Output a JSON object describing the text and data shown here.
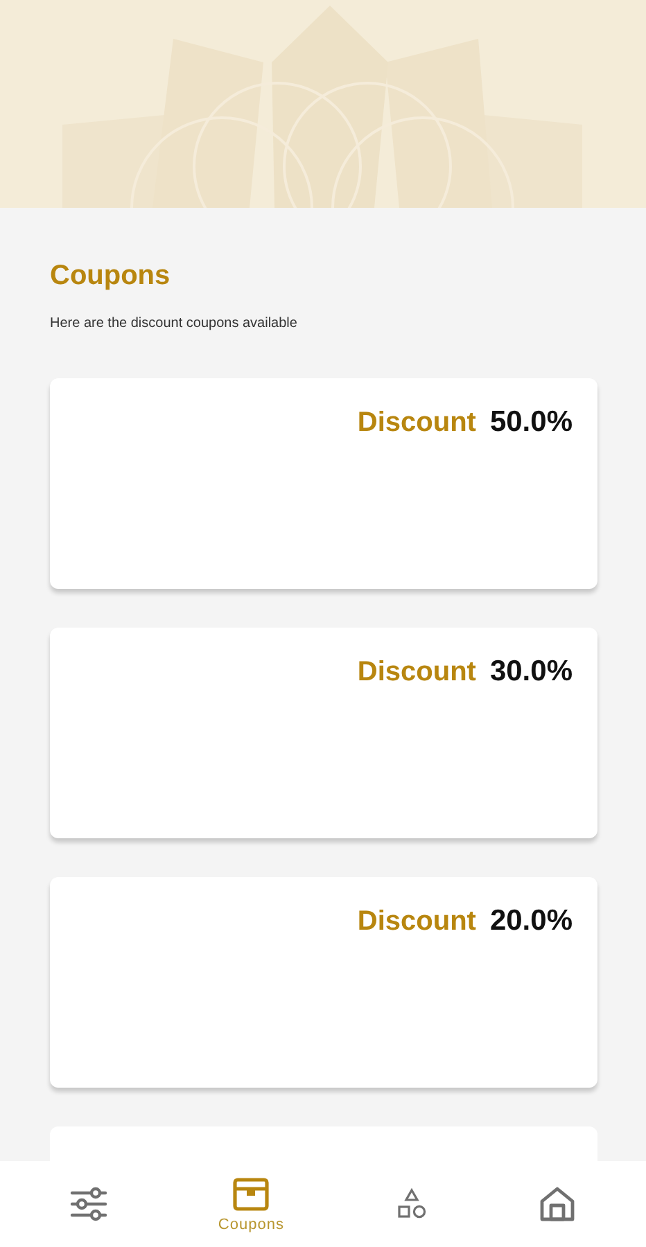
{
  "title": "Coupons",
  "subtitle": "Here are the discount coupons available",
  "coupons": [
    {
      "kind": "discount",
      "label": "Discount",
      "value": "50.0%"
    },
    {
      "kind": "discount",
      "label": "Discount",
      "value": "30.0%"
    },
    {
      "kind": "discount",
      "label": "Discount",
      "value": "20.0%"
    },
    {
      "kind": "cut_off"
    }
  ],
  "nav": [
    {
      "kind": "sliders",
      "selected": false
    },
    {
      "kind": "box",
      "label": "Coupons",
      "selected": true
    },
    {
      "kind": "shapes",
      "selected": false
    },
    {
      "kind": "home",
      "selected": false
    }
  ]
}
